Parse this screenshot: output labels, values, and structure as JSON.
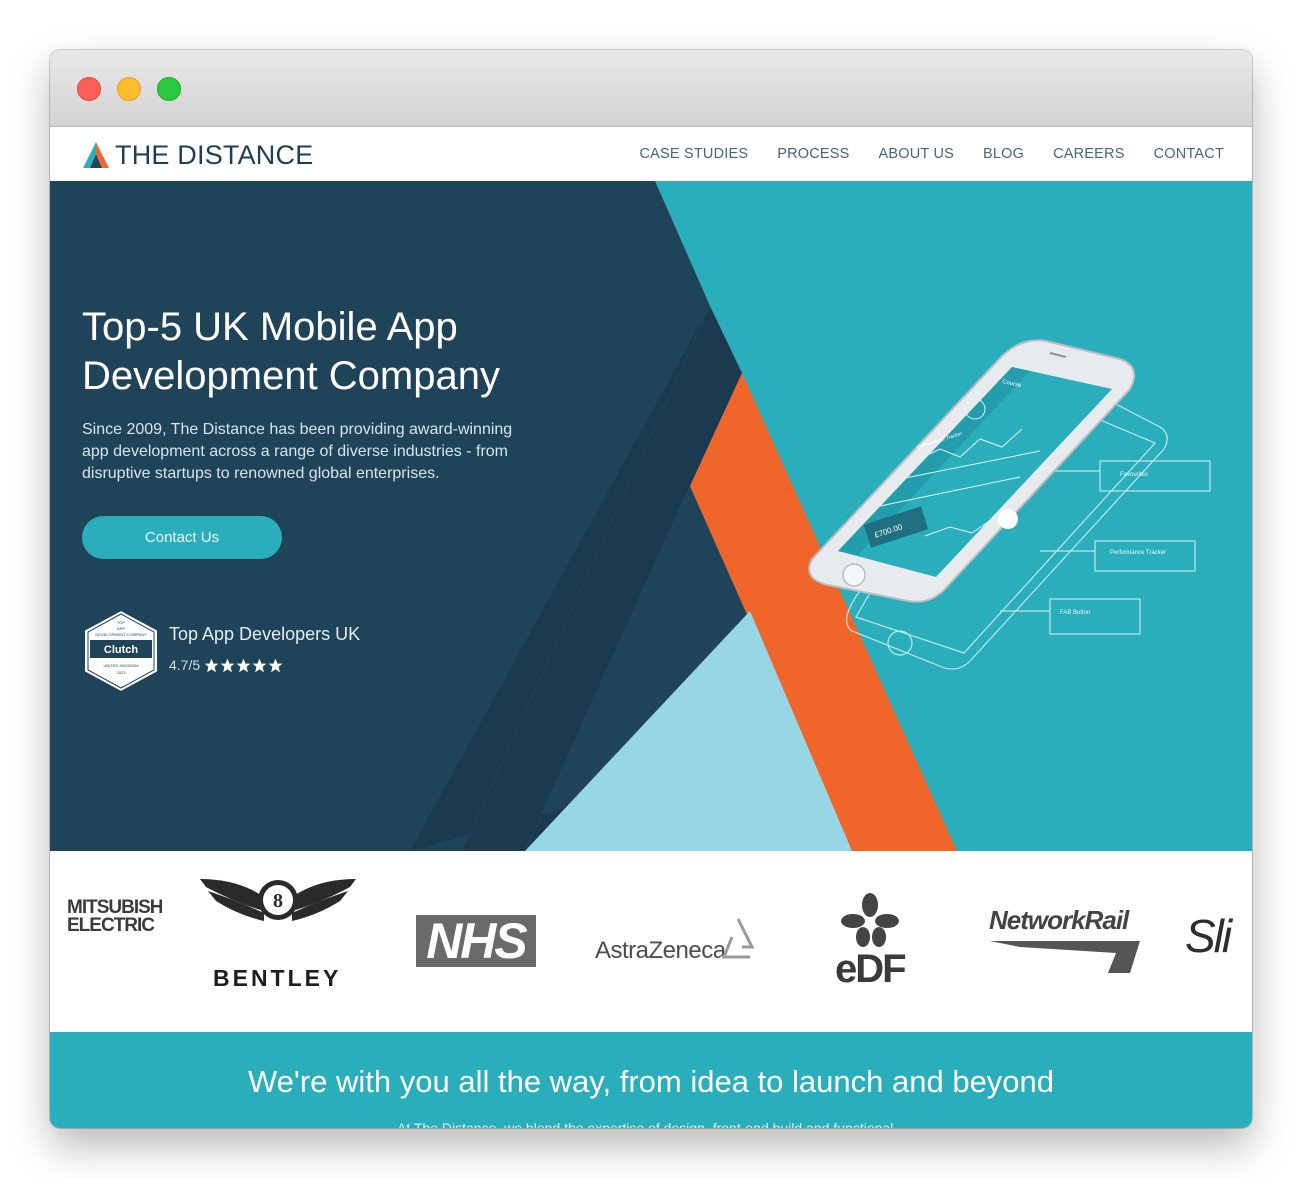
{
  "window": {
    "controls": [
      "close",
      "minimize",
      "zoom"
    ]
  },
  "nav": {
    "logo_text": "THE DISTANCE",
    "links": [
      "CASE STUDIES",
      "PROCESS",
      "ABOUT US",
      "BLOG",
      "CAREERS",
      "CONTACT"
    ]
  },
  "hero": {
    "title_line1": "Top-5 UK Mobile App",
    "title_line2": "Development Company",
    "description": "Since 2009, The Distance has been providing award-winning app development across a range of diverse industries - from disruptive startups to renowned global enterprises.",
    "cta_label": "Contact Us",
    "clutch": {
      "badge_top": "TOP",
      "badge_line2": "APP",
      "badge_line3": "DEVELOPMENT COMPANY",
      "badge_brand": "Clutch",
      "badge_country": "UNITED KINGDOM",
      "badge_year": "2023",
      "title": "Top App Developers UK",
      "score": "4.7/5",
      "stars": 5
    },
    "phone": {
      "screen_title": "Course",
      "amount": "£700.00",
      "tracker_label": "Performance Tracker",
      "callouts": [
        "Favourites",
        "Performance Tracker",
        "FAB Button"
      ]
    }
  },
  "clients": [
    "MITSUBISHI ELECTRIC",
    "BENTLEY",
    "NHS",
    "AstraZeneca",
    "eDF",
    "NetworkRail",
    "Sli"
  ],
  "band": {
    "title": "We're with you all the way, from idea to launch and beyond",
    "subtitle": "At The Distance, we blend the expertise of design, front-end build and functional..."
  },
  "colors": {
    "navy": "#1f4358",
    "teal": "#2aaebb",
    "orange": "#f0662a",
    "light_blue": "#97d7e5"
  }
}
